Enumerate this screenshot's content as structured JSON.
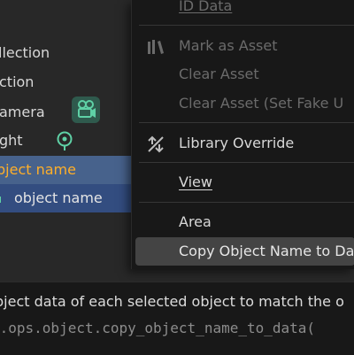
{
  "outliner": {
    "rows": [
      {
        "label": "llection"
      },
      {
        "label": "ction"
      },
      {
        "label": "amera"
      },
      {
        "label": "ght"
      },
      {
        "label": "bject name"
      },
      {
        "label": "object name"
      }
    ]
  },
  "context_menu": {
    "items": [
      {
        "label": "ID Data"
      },
      {
        "label": "Mark as Asset"
      },
      {
        "label": "Clear Asset"
      },
      {
        "label": "Clear Asset (Set Fake U"
      },
      {
        "label": "Library Override"
      },
      {
        "label": "View"
      },
      {
        "label": "Area"
      },
      {
        "label": "Copy Object Name to Da"
      }
    ]
  },
  "tooltip": {
    "description": "bject data of each selected object to match the o",
    "python": "y.ops.object.copy_object_name_to_data("
  },
  "colors": {
    "selection": "#47628c",
    "active_text": "#ffaf29",
    "camera_icon": "#5fd1a6"
  }
}
